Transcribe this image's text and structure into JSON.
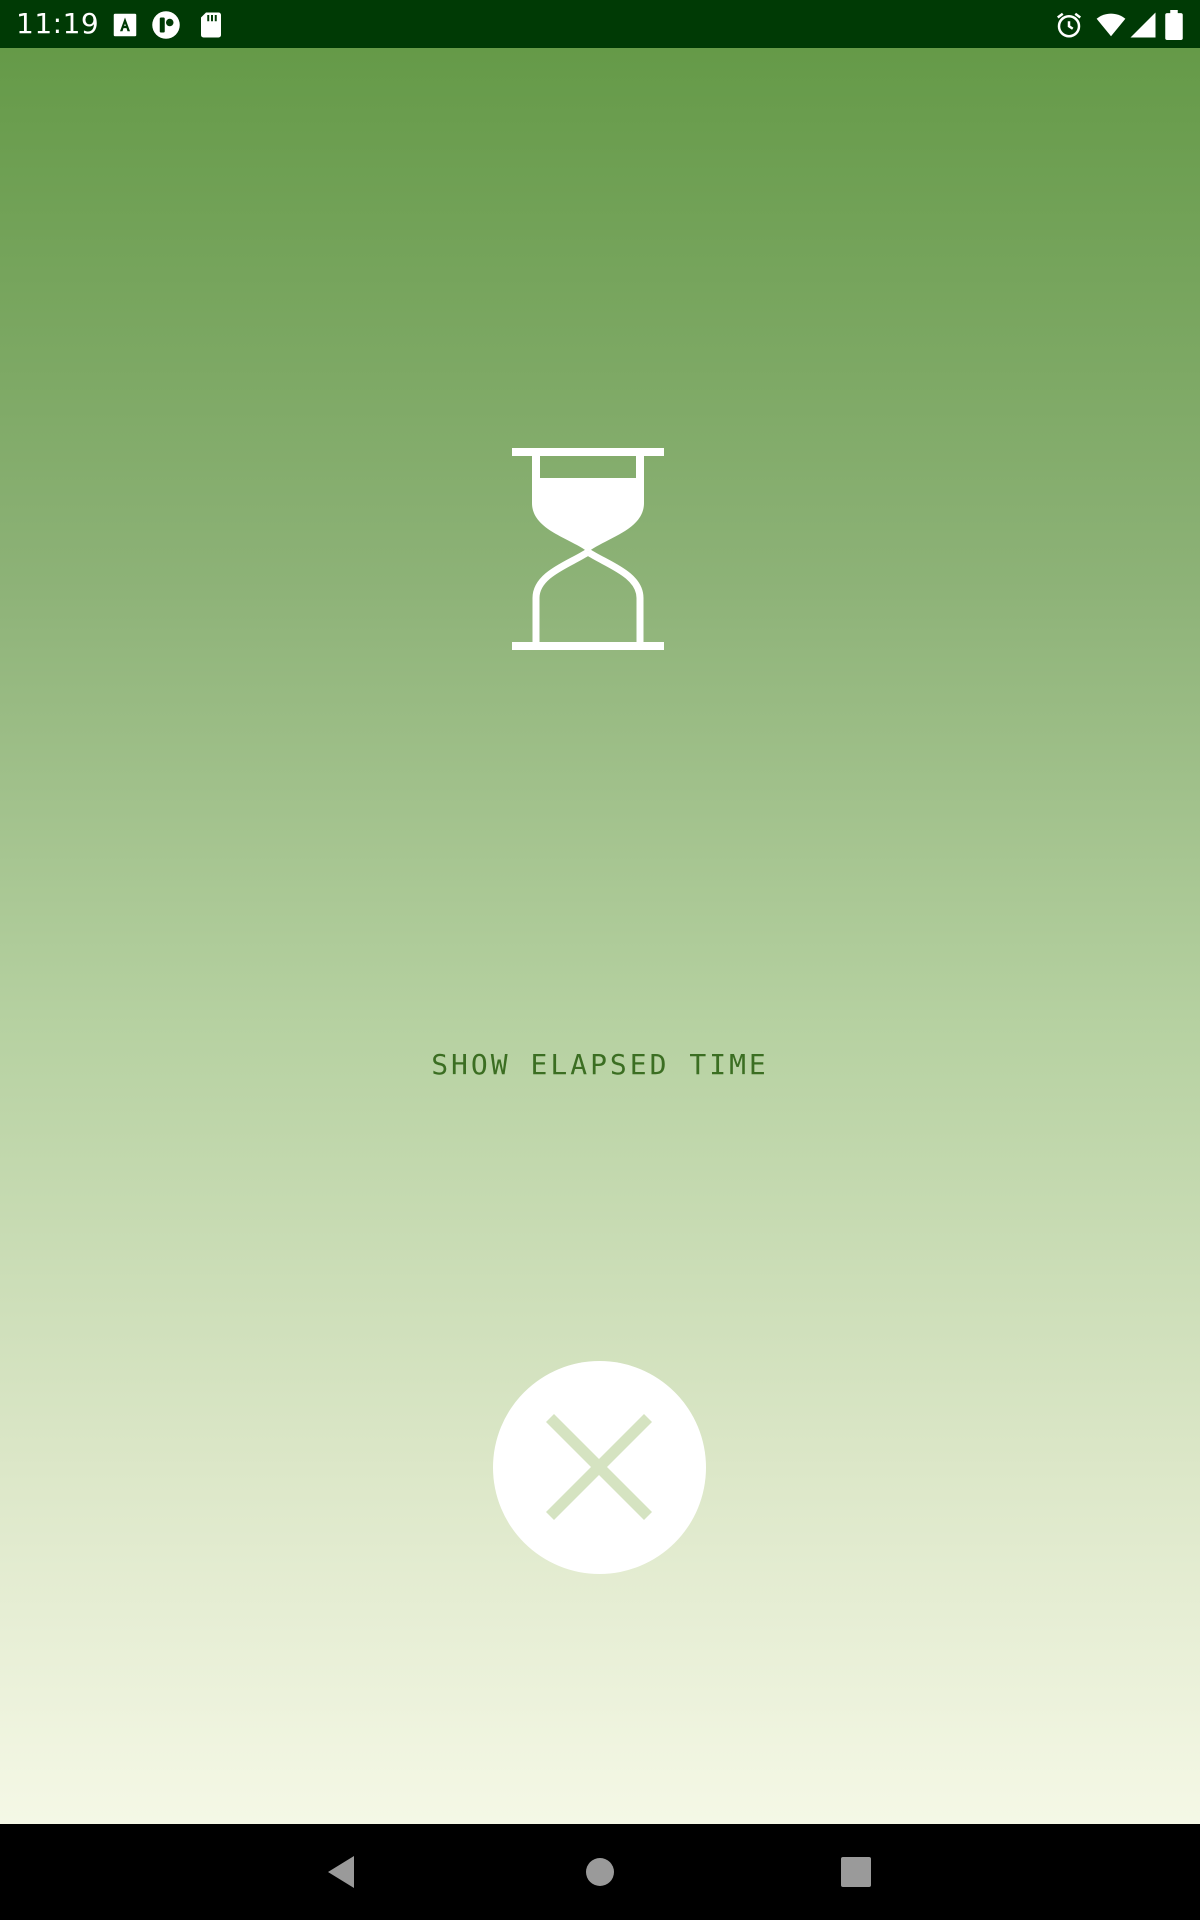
{
  "status_bar": {
    "time": "11:19",
    "left_icons": [
      "font-download-icon",
      "pocket-casts-icon",
      "sd-card-icon"
    ],
    "right_icons": [
      "alarm-icon",
      "wifi-icon",
      "signal-icon",
      "battery-icon"
    ]
  },
  "main": {
    "icon": "hourglass-icon",
    "label": "SHOW ELAPSED TIME",
    "close_icon": "close-icon"
  },
  "nav_bar": {
    "buttons": [
      "back-icon",
      "home-icon",
      "recents-icon"
    ]
  },
  "colors": {
    "status_bar_bg": "#003a05",
    "gradient_top": "#659a48",
    "gradient_bottom": "#f5f8e6",
    "label_color": "#3b6e22",
    "close_x_color": "#d5e3c1"
  }
}
